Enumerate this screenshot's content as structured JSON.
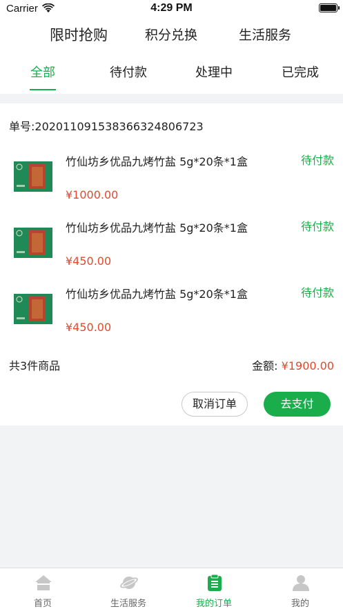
{
  "status_bar": {
    "carrier": "Carrier",
    "time": "4:29 PM"
  },
  "top_nav": [
    "限时抢购",
    "积分兑换",
    "生活服务"
  ],
  "tabs": [
    "全部",
    "待付款",
    "处理中",
    "已完成"
  ],
  "order": {
    "order_no": "单号:20201109153836632480​6723",
    "products": [
      {
        "name": "竹仙坊乡优品九烤竹盐 5g*20条*1盒",
        "status": "待付款",
        "price": "¥1000.00"
      },
      {
        "name": "竹仙坊乡优品九烤竹盐 5g*20条*1盒",
        "status": "待付款",
        "price": "¥450.00"
      },
      {
        "name": "竹仙坊乡优品九烤竹盐 5g*20条*1盒",
        "status": "待付款",
        "price": "¥450.00"
      }
    ],
    "count_text": "共3件商品",
    "total_label": "金额: ",
    "total_amount": "¥1900.00",
    "cancel_label": "取消订单",
    "pay_label": "去支付"
  },
  "tabbar": [
    {
      "label": "首页",
      "icon": "home-icon"
    },
    {
      "label": "生活服务",
      "icon": "planet-icon"
    },
    {
      "label": "我的订单",
      "icon": "clipboard-icon"
    },
    {
      "label": "我的",
      "icon": "user-icon"
    }
  ],
  "colors": {
    "accent": "#1aad4b",
    "price": "#e8462b",
    "background": "#f2f3f5"
  }
}
